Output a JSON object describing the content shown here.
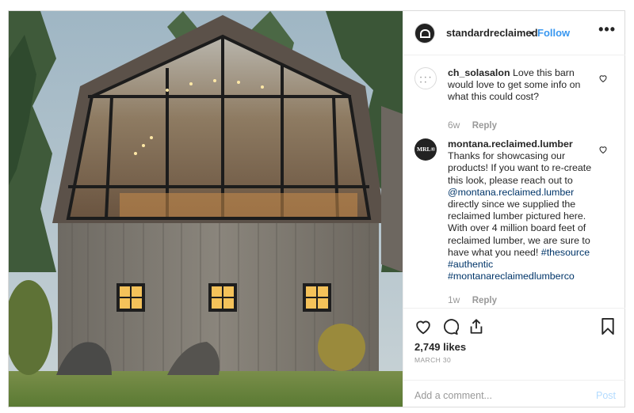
{
  "post": {
    "username": "standardreclaimed",
    "separator": "•",
    "follow_label": "Follow",
    "more_icon": "more-horizontal-icon"
  },
  "comments": [
    {
      "username": "ch_solasalon",
      "text": "Love this barn would love to get some info on what this could cost?",
      "age": "6w",
      "reply_label": "Reply"
    },
    {
      "username": "montana.reclaimed.lumber",
      "avatar_text": "MRL®",
      "text_before": "Thanks for showcasing our products! If you want to re-create this look, please reach out to ",
      "mention": "@montana.reclaimed.lumber",
      "text_after": " directly since we supplied the reclaimed lumber pictured here. With over 4 million board feet of reclaimed lumber, we are sure to have what you need! ",
      "hashtags": [
        "#thesource",
        "#authentic",
        "#montanareclaimedlumberco"
      ],
      "age": "1w",
      "reply_label": "Reply"
    }
  ],
  "actions": {
    "like_icon": "heart-icon",
    "comment_icon": "comment-icon",
    "share_icon": "share-icon",
    "save_icon": "bookmark-icon"
  },
  "likes": "2,749 likes",
  "date": "MARCH 30",
  "add_comment": {
    "placeholder": "Add a comment...",
    "post_label": "Post"
  },
  "colors": {
    "link": "#003569",
    "follow": "#3897f0",
    "muted": "#999999",
    "post_disabled": "#b3dbff"
  }
}
